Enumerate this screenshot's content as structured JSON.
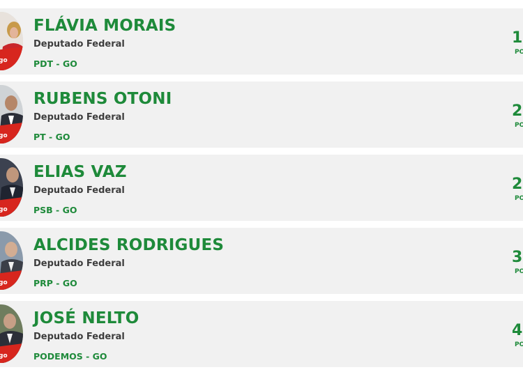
{
  "colors": {
    "accent": "#1e8a3a",
    "card_background": "#f1f1f1",
    "role_text": "#3d3d3d",
    "badge_red": "#d7261e"
  },
  "deputies": [
    {
      "name": "FLÁVIA MORAIS",
      "role": "Deputado Federal",
      "party": "PDT - GO",
      "rank": "1",
      "rank_label": "PO"
    },
    {
      "name": "RUBENS OTONI",
      "role": "Deputado Federal",
      "party": "PT - GO",
      "rank": "2",
      "rank_label": "PO"
    },
    {
      "name": "ELIAS VAZ",
      "role": "Deputado Federal",
      "party": "PSB - GO",
      "rank": "2",
      "rank_label": "PO"
    },
    {
      "name": "ALCIDES RODRIGUES",
      "role": "Deputado Federal",
      "party": "PRP - GO",
      "rank": "3",
      "rank_label": "PO"
    },
    {
      "name": "JOSÉ NELTO",
      "role": "Deputado Federal",
      "party": "PODEMOS - GO",
      "rank": "4",
      "rank_label": "PO"
    }
  ]
}
